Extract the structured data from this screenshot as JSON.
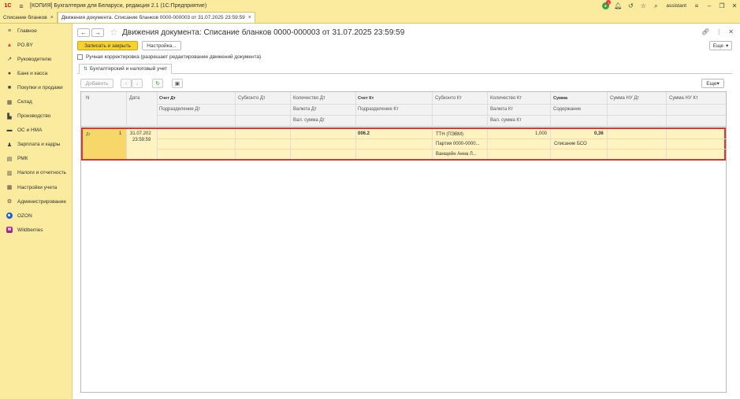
{
  "app": {
    "window_title": "[КОПИЯ] Бухгалтерия для Беларуси, редакция 2.1  (1С:Предприятие)",
    "logo_text": "1С",
    "notification_count": "1",
    "user": "assistant"
  },
  "tabs": [
    {
      "label": "Списание бланков"
    },
    {
      "label": "Движения документа. Списание бланков 0000-000003 от 31.07.2025 23:59:59"
    }
  ],
  "sidebar": {
    "items": [
      {
        "label": "Главное",
        "icon": "menu-icon"
      },
      {
        "label": "PO.BY",
        "icon": "poby-icon"
      },
      {
        "label": "Руководителю",
        "icon": "trend-icon"
      },
      {
        "label": "Банк и касса",
        "icon": "bank-icon"
      },
      {
        "label": "Покупки и продажи",
        "icon": "cart-icon"
      },
      {
        "label": "Склад",
        "icon": "warehouse-icon"
      },
      {
        "label": "Производство",
        "icon": "factory-icon"
      },
      {
        "label": "ОС и НМА",
        "icon": "truck-icon"
      },
      {
        "label": "Зарплата и кадры",
        "icon": "person-icon"
      },
      {
        "label": "РМК",
        "icon": "register-icon"
      },
      {
        "label": "Налоги и отчетность",
        "icon": "taxes-icon"
      },
      {
        "label": "Настройки учета",
        "icon": "settings-grid-icon"
      },
      {
        "label": "Администрирование",
        "icon": "gear-icon"
      },
      {
        "label": "OZON",
        "icon": "ozon-icon"
      },
      {
        "label": "Wildberries",
        "icon": "wildberries-icon"
      }
    ]
  },
  "document": {
    "title": "Движения документа: Списание бланков 0000-000003 от 31.07.2025 23:59:59",
    "save_close_label": "Записать и закрыть",
    "settings_label": "Настройка...",
    "more_label": "Еще",
    "manual_correction_label": "Ручная корректировка (разрешает редактирование движений документа)"
  },
  "register_tab": {
    "label": "Бухгалтерский и налоговый учет"
  },
  "table_toolbar": {
    "add_label": "Добавить",
    "more_label": "Еще"
  },
  "table": {
    "headers": {
      "n": "N",
      "date": "Дата",
      "acc_dt": "Счет Дт",
      "div_dt": "Подразделение Дт",
      "subconto_dt": "Субконто Дт",
      "qty_dt": "Количество Дт",
      "cur_dt": "Валюта Дт",
      "cur_sum_dt": "Вал. сумма Дт",
      "acc_kt": "Счет Кт",
      "div_kt": "Подразделение Кт",
      "subconto_kt": "Субконто Кт",
      "qty_kt": "Количество Кт",
      "cur_kt": "Валюта Кт",
      "cur_sum_kt": "Вал. сумма Кт",
      "sum": "Сумма",
      "content": "Содержание",
      "sum_nu_dt": "Сумма НУ Дт",
      "sum_nu_kt": "Сумма НУ Кт"
    },
    "rows": [
      {
        "n": "1",
        "date_line1": "31.07.202",
        "date_line2": "23:59:59",
        "acc_kt": "006.2",
        "subconto_kt_1": "ТТН (ПЭВМ)",
        "subconto_kt_2": "Партия 0000-0000...",
        "subconto_kt_3": "Ванщейн Анна Л...",
        "qty_kt": "1,000",
        "sum": "0,36",
        "content": "Списание БСО"
      }
    ]
  }
}
